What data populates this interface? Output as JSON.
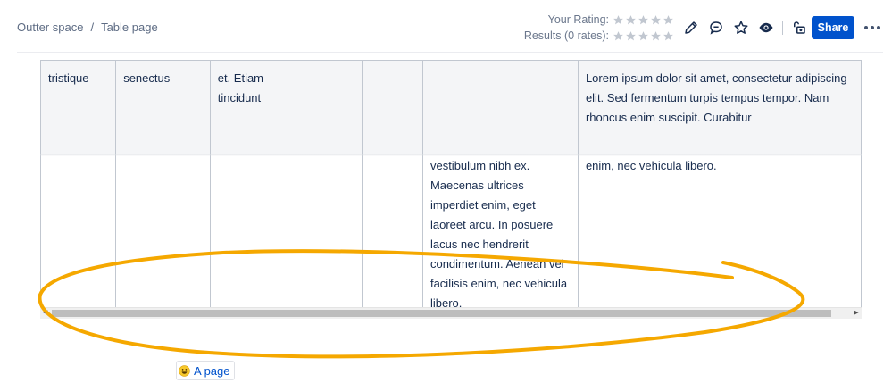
{
  "breadcrumb": {
    "space": "Outter space",
    "separator": "/",
    "page": "Table page"
  },
  "rating": {
    "your_label": "Your Rating:",
    "results_label": "Results (0 rates):",
    "your_stars_filled": 0,
    "results_stars_filled": 0,
    "star_count": 5
  },
  "toolbar": {
    "icons": [
      "edit-icon",
      "comment-icon",
      "star-icon",
      "watch-eye-icon",
      "unlock-icon"
    ],
    "share_label": "Share",
    "more_label": "More actions"
  },
  "table": {
    "header": [
      "tristique",
      "senectus",
      "et. Etiam tincidunt",
      "",
      "",
      "",
      "Lorem ipsum dolor sit amet, consectetur adipiscing elit. Sed fermentum turpis tempus tempor. Nam rhoncus enim suscipit. Curabitur"
    ],
    "body": [
      "",
      "",
      "",
      "",
      "",
      "vestibulum nibh ex. Maecenas ultrices imperdiet enim, eget laoreet arcu. In posuere lacus nec hendrerit condimentum. Aenean vel facilisis enim, nec vehicula libero.",
      "enim, nec vehicula libero."
    ]
  },
  "scrollbar": {
    "orientation": "horizontal"
  },
  "annotation": {
    "color": "#f5a800"
  },
  "page_link": {
    "label": "A page",
    "emoji": "smiley-emoji-icon"
  },
  "colors": {
    "accent": "#0052cc",
    "star_empty": "#c1c7d0",
    "header_bg": "#f4f5f7"
  }
}
